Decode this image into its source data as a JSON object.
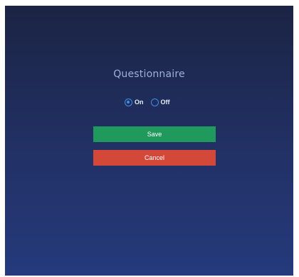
{
  "dialog": {
    "title": "Questionnaire",
    "options": [
      {
        "label": "On",
        "selected": true
      },
      {
        "label": "Off",
        "selected": false
      }
    ],
    "save_label": "Save",
    "cancel_label": "Cancel"
  },
  "colors": {
    "background_top": "#1b2444",
    "background_bottom": "#253a7c",
    "radio_accent": "#3d8ee8",
    "save_button": "#1f9a5c",
    "cancel_button": "#d4483a"
  }
}
